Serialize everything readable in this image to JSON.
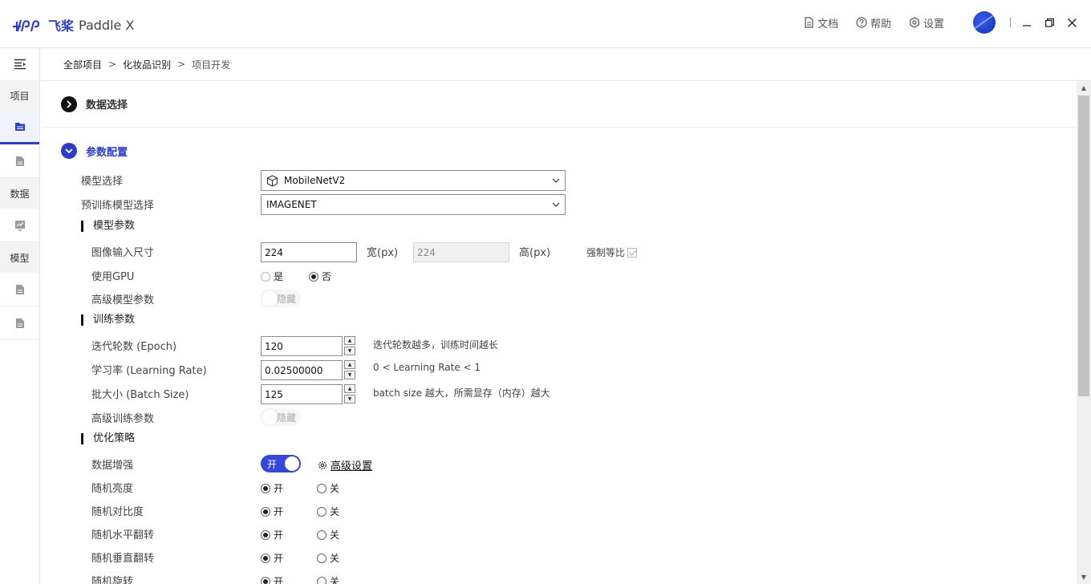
{
  "app": {
    "logo_mark": "㊣",
    "logo_cn": "飞桨",
    "logo_en": "Paddle X"
  },
  "header": {
    "docs_label": "文档",
    "help_label": "帮助",
    "settings_label": "设置",
    "minimize": "—",
    "restore": "❐",
    "close": "✕"
  },
  "rail": {
    "menu_icon": "menu-collapse-icon",
    "sections": [
      "项目",
      "数据",
      "模型"
    ]
  },
  "breadcrumb": {
    "items": [
      "全部项目",
      "化妆品识别",
      "项目开发"
    ],
    "sep": ">"
  },
  "sections": {
    "data_select": "数据选择",
    "param_config": "参数配置"
  },
  "form": {
    "model_select_label": "模型选择",
    "model_select_value": "MobileNetV2",
    "pretrain_label": "预训练模型选择",
    "pretrain_value": "IMAGENET",
    "model_params_head": "模型参数",
    "input_size_label": "图像输入尺寸",
    "width_value": "224",
    "width_unit": "宽(px)",
    "height_value": "224",
    "height_unit": "高(px)",
    "keep_ratio_label": "强制等比",
    "gpu_label": "使用GPU",
    "gpu_yes": "是",
    "gpu_no": "否",
    "adv_model_label": "高级模型参数",
    "adv_model_toggle": "隐藏",
    "train_params_head": "训练参数",
    "epoch_label": "迭代轮数 (Epoch)",
    "epoch_value": "120",
    "epoch_hint": "迭代轮数越多，训练时间越长",
    "lr_label": "学习率 (Learning Rate)",
    "lr_value": "0.02500000",
    "lr_hint": "0 < Learning Rate < 1",
    "batch_label": "批大小 (Batch Size)",
    "batch_value": "125",
    "batch_hint": "batch size 越大，所需显存（内存）越大",
    "adv_train_label": "高级训练参数",
    "adv_train_toggle": "隐藏",
    "optim_head": "优化策略",
    "aug_label": "数据增强",
    "aug_toggle": "开",
    "adv_settings_link": "高级设置",
    "radio_on": "开",
    "radio_off": "关",
    "aug_items": [
      "随机亮度",
      "随机对比度",
      "随机水平翻转",
      "随机垂直翻转",
      "随机旋转"
    ]
  },
  "colors": {
    "brand": "#2d3ec2",
    "toggle_on": "#3646d6"
  }
}
